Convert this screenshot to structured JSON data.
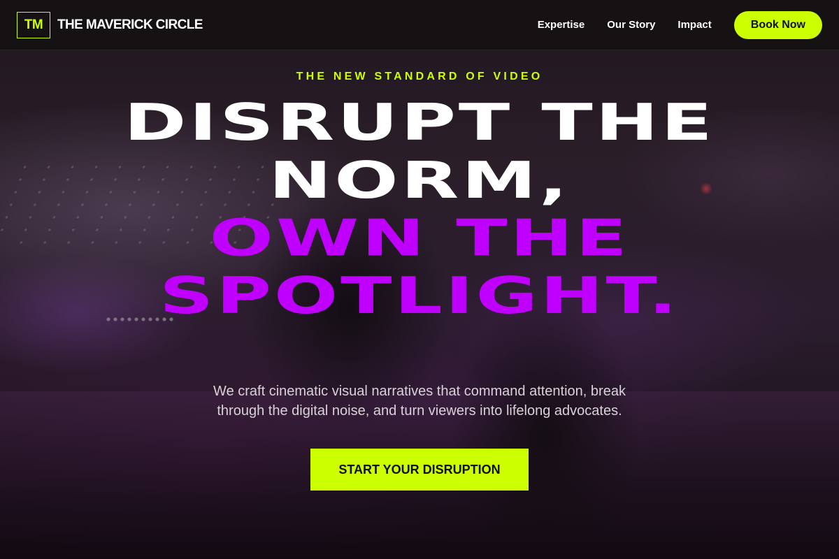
{
  "colors": {
    "accent": "#ccff00",
    "headline_highlight": "#c000ff",
    "nav_bg": "#161214"
  },
  "brand": {
    "logo_text": "TM",
    "name": "THE MAVERICK CIRCLE"
  },
  "nav": {
    "links": [
      "Expertise",
      "Our Story",
      "Impact"
    ],
    "cta_label": "Book Now"
  },
  "hero": {
    "background_image": "camera-operator-photo",
    "eyebrow": "THE NEW STANDARD OF VIDEO",
    "headline_lines": [
      "DISRUPT THE",
      "NORM,",
      "OWN THE",
      "SPOTLIGHT."
    ],
    "subcopy": "We craft cinematic visual narratives that command attention, break through the digital noise, and turn viewers into lifelong advocates.",
    "cta_label": "START YOUR DISRUPTION"
  }
}
